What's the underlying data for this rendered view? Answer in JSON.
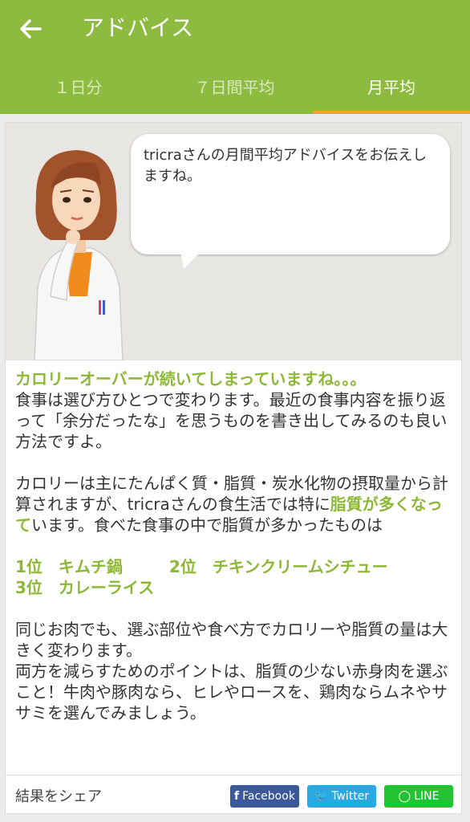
{
  "appbar": {
    "title": "アドバイス",
    "back_icon": "arrow-left-icon"
  },
  "tabs": [
    {
      "label": "１日分",
      "active": false
    },
    {
      "label": "７日間平均",
      "active": false
    },
    {
      "label": "月平均",
      "active": true
    }
  ],
  "bubble": {
    "text": "tricraさんの月間平均アドバイスをお伝えしますね。"
  },
  "advice": {
    "headline": "カロリーオーバーが続いてしまっていますね。。。",
    "para1": "食事は選び方ひとつで変わります。最近の食事内容を振り返って「余分だったな」を思うものを書き出してみるのも良い方法ですよ。",
    "para2_a": "カロリーは主にたんぱく質・脂質・炭水化物の摂取量から計算されますが、tricraさんの食生活では特に",
    "para2_hl": "脂質が多くなって",
    "para2_b": "います。食べた食事の中で脂質が多かったものは",
    "rank1": "1位　キムチ鍋",
    "rank2": "2位　チキンクリームシチュー",
    "rank3": "3位　カレーライス",
    "para3": "同じお肉でも、選ぶ部位や食べ方でカロリーや脂質の量は大きく変わります。",
    "para4": "両方を減らすためのポイントは、脂質の少ない赤身肉を選ぶこと！牛肉や豚肉なら、ヒレやロースを、鶏肉ならムネやササミを選んでみましょう。"
  },
  "share": {
    "label": "結果をシェア",
    "facebook": "Facebook",
    "twitter": "Twitter",
    "line": "LINE"
  },
  "colors": {
    "appbar": "#8dbb3f",
    "accent": "#8db836",
    "tab_indicator": "#f4a23b"
  }
}
